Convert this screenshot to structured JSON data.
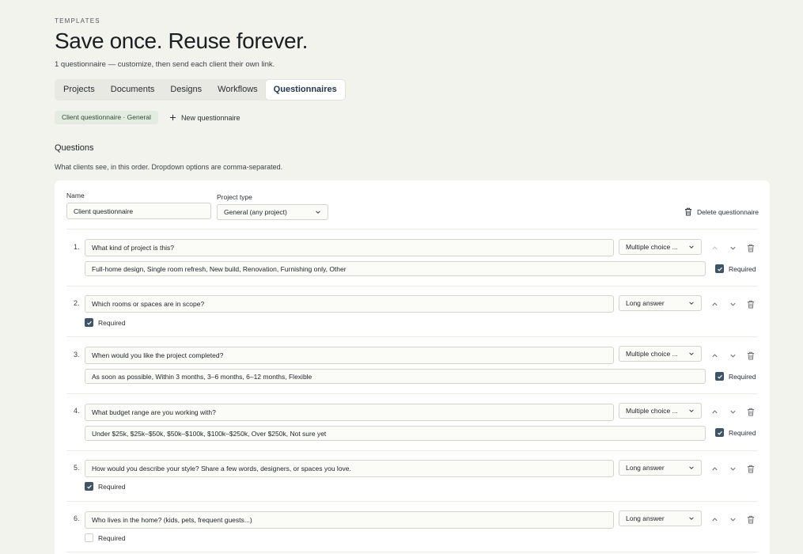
{
  "header": {
    "eyebrow": "TEMPLATES",
    "title": "Save once. Reuse forever.",
    "subtitle": "1 questionnaire — customize, then send each client their own link."
  },
  "tabs": [
    {
      "label": "Projects",
      "active": false
    },
    {
      "label": "Documents",
      "active": false
    },
    {
      "label": "Designs",
      "active": false
    },
    {
      "label": "Workflows",
      "active": false
    },
    {
      "label": "Questionnaires",
      "active": true
    }
  ],
  "chips": {
    "selected": "Client questionnaire · General",
    "new_label": "New questionnaire"
  },
  "section": {
    "title": "Questions",
    "description": "What clients see, in this order. Dropdown options are comma-separated."
  },
  "form": {
    "name_label": "Name",
    "name_value": "Client questionnaire",
    "type_label": "Project type",
    "type_value": "General (any project)",
    "delete_label": "Delete questionnaire"
  },
  "questions": [
    {
      "num": "1.",
      "text": "What kind of project is this?",
      "type": "Multiple choice ...",
      "options": "Full-home design, Single room refresh, New build, Renovation, Furnishing only, Other",
      "required": true,
      "required_label": "Required"
    },
    {
      "num": "2.",
      "text": "Which rooms or spaces are in scope?",
      "type": "Long answer",
      "options": null,
      "required": true,
      "required_label": "Required"
    },
    {
      "num": "3.",
      "text": "When would you like the project completed?",
      "type": "Multiple choice ...",
      "options": "As soon as possible, Within 3 months, 3–6 months, 6–12 months, Flexible",
      "required": true,
      "required_label": "Required"
    },
    {
      "num": "4.",
      "text": "What budget range are you working with?",
      "type": "Multiple choice ...",
      "options": "Under $25k, $25k–$50k, $50k–$100k, $100k–$250k, Over $250k, Not sure yet",
      "required": true,
      "required_label": "Required"
    },
    {
      "num": "5.",
      "text": "How would you describe your style? Share a few words, designers, or spaces you love.",
      "type": "Long answer",
      "options": null,
      "required": true,
      "required_label": "Required"
    },
    {
      "num": "6.",
      "text": "Who lives in the home? (kids, pets, frequent guests...)",
      "type": "Long answer",
      "options": null,
      "required": false,
      "required_label": "Required"
    }
  ],
  "colors": {
    "background": "#f3f3ee",
    "accent": "#3d5566",
    "chip_bg": "#e4ebe0",
    "active_tab_text": "#263a4d"
  },
  "icons": {
    "new": "plus-icon",
    "delete": "trash-icon",
    "dropdown": "chevron-down-icon",
    "move_up": "chevron-up-icon",
    "move_down": "chevron-down-icon",
    "check": "check-icon"
  }
}
